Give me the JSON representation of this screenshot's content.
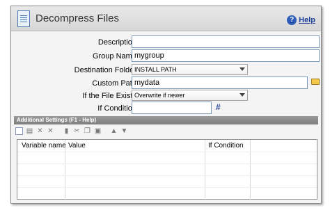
{
  "window": {
    "title": "Decompress Files",
    "help_label": "Help",
    "help_icon": "help-icon"
  },
  "form": {
    "description": {
      "label": "Description:",
      "value": ""
    },
    "group_name": {
      "label": "Group Name:",
      "value": "mygroup"
    },
    "destination_folder": {
      "label": "Destination Folder:",
      "selected": "INSTALL PATH"
    },
    "custom_path": {
      "label": "Custom Path:",
      "value": "mydata"
    },
    "if_file_exists": {
      "label": "If the File Exists:",
      "selected": "Overwrite if newer"
    },
    "if_condition": {
      "label": "If Condition:",
      "value": "",
      "hash_symbol": "#"
    }
  },
  "settings": {
    "bar_title": "Additional Settings (F1 - Help)",
    "toolbar": [
      "new-icon",
      "paste-icon",
      "delete-icon",
      "delete-all-icon",
      "copy-icon",
      "cut-icon",
      "duplicate-icon",
      "properties-icon",
      "move-up-icon",
      "move-down-icon"
    ],
    "columns": [
      "Variable name",
      "Value",
      "If Condition",
      ""
    ]
  },
  "colors": {
    "link": "#1f3f99",
    "bar": "#888888"
  }
}
